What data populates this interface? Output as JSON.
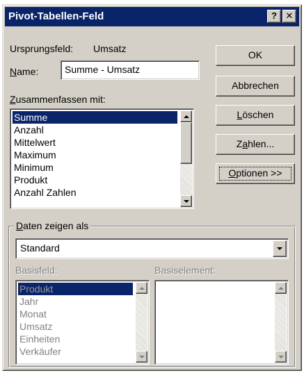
{
  "window": {
    "title": "Pivot-Tabellen-Feld",
    "help_label": "?",
    "close_label": "✕"
  },
  "source": {
    "label": "Ursprungsfeld:",
    "value": "Umsatz"
  },
  "name": {
    "label_ul": "N",
    "label_rest": "ame:",
    "value": "Summe - Umsatz"
  },
  "summarize": {
    "label_ul": "Z",
    "label_rest": "usammenfassen mit:",
    "items": [
      "Summe",
      "Anzahl",
      "Mittelwert",
      "Maximum",
      "Minimum",
      "Produkt",
      "Anzahl Zahlen"
    ],
    "selected_index": 0
  },
  "buttons": {
    "ok": "OK",
    "cancel": "Abbrechen",
    "delete_ul": "L",
    "delete_rest": "öschen",
    "numbers_pre": "Z",
    "numbers_ul": "a",
    "numbers_rest": "hlen...",
    "options_ul": "O",
    "options_rest": "ptionen >>"
  },
  "show_data": {
    "group_ul": "D",
    "group_rest": "aten zeigen als",
    "selected": "Standard",
    "base_field_label": "Basisfeld:",
    "base_item_label": "Basiselement:",
    "base_fields": [
      "Produkt",
      "Jahr",
      "Monat",
      "Umsatz",
      "Einheiten",
      "Verkäufer"
    ],
    "base_items": []
  }
}
